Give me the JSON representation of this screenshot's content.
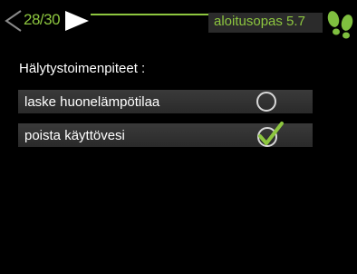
{
  "header": {
    "page_counter": "28/30",
    "title": "aloitusopas 5.7",
    "nav_prev_icon": "chevron-left-icon",
    "nav_next_icon": "play-right-icon",
    "help_icon": "footsteps-icon",
    "accent_color": "#8dc63f"
  },
  "main": {
    "heading": "Hälytystoimenpiteet :",
    "options": [
      {
        "label": "laske huonelämpötilaa",
        "selected": false,
        "icon": "radio-unchecked-icon"
      },
      {
        "label": "poista käyttövesi",
        "selected": true,
        "icon": "checkmark-icon"
      }
    ]
  }
}
